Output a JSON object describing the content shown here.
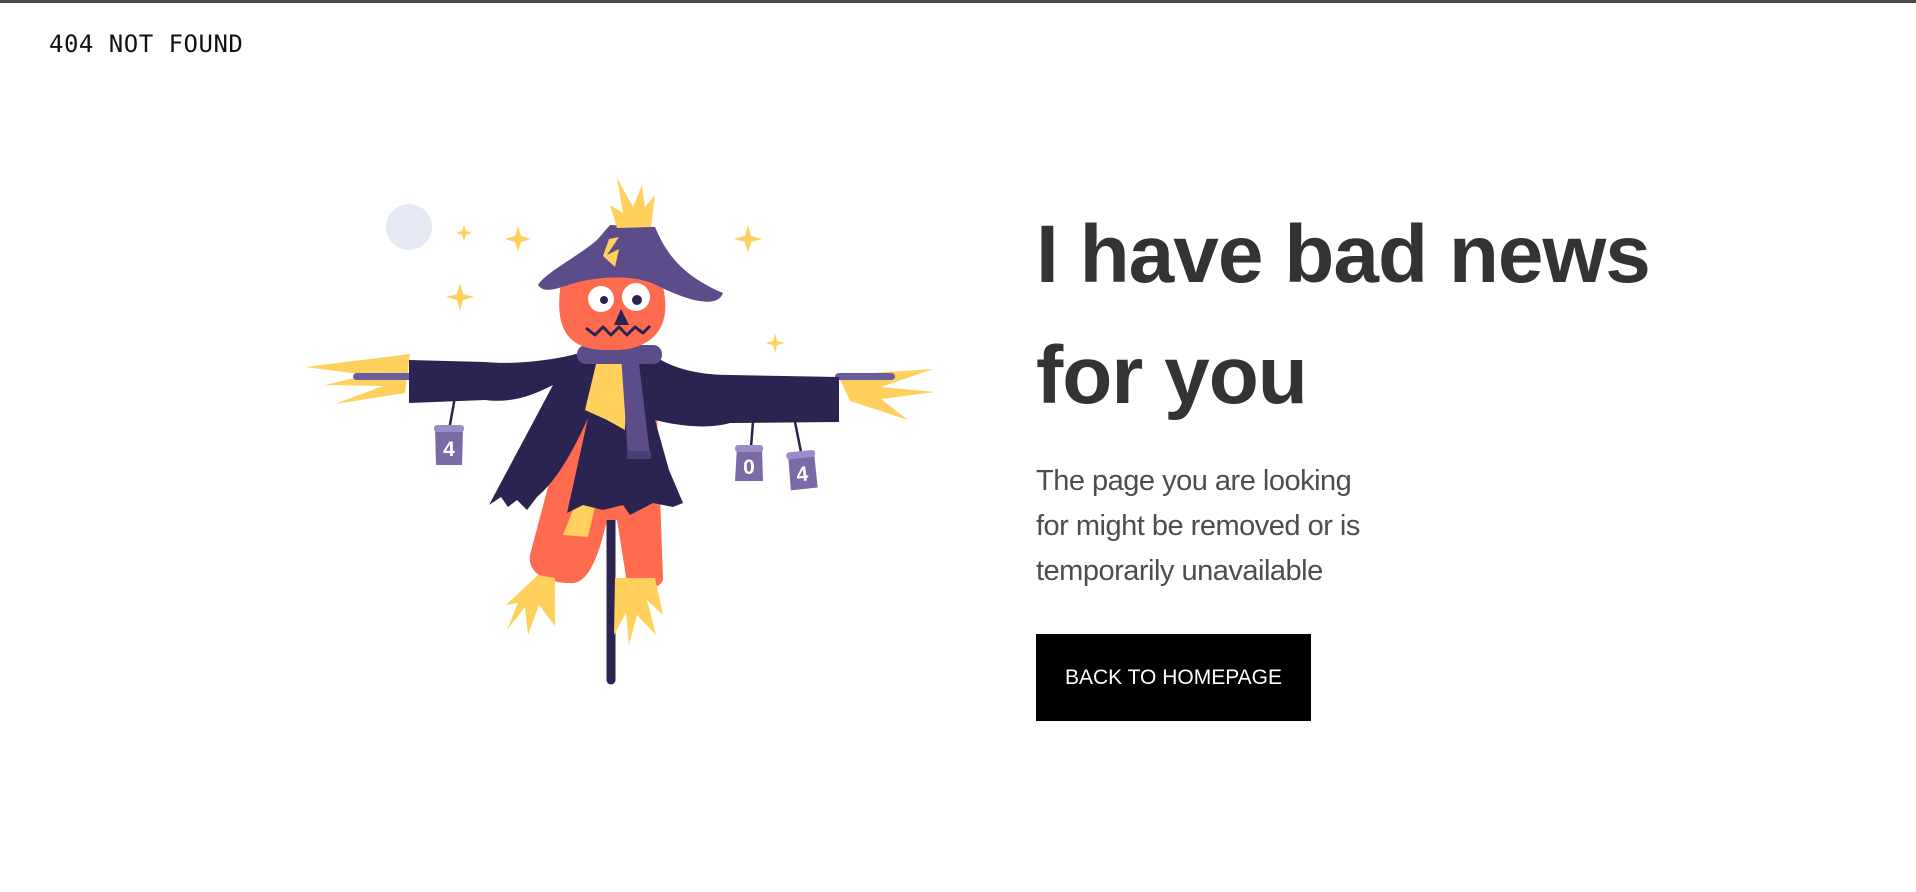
{
  "header": {
    "title": "404 NOT FOUND"
  },
  "illustration": {
    "can_digits": [
      "4",
      "0",
      "4"
    ],
    "colors": {
      "hat": "#5c4d8a",
      "jacket": "#2b2350",
      "face": "#ff6b4f",
      "straw": "#ffd05c",
      "can": "#7b6aa6",
      "moon": "#e6e9f4",
      "pole": "#2b2350"
    }
  },
  "main": {
    "headline": "I have bad news for you",
    "description": "The page you are looking for might be removed or is temporarily unavailable",
    "button_label": "BACK TO HOMEPAGE"
  }
}
